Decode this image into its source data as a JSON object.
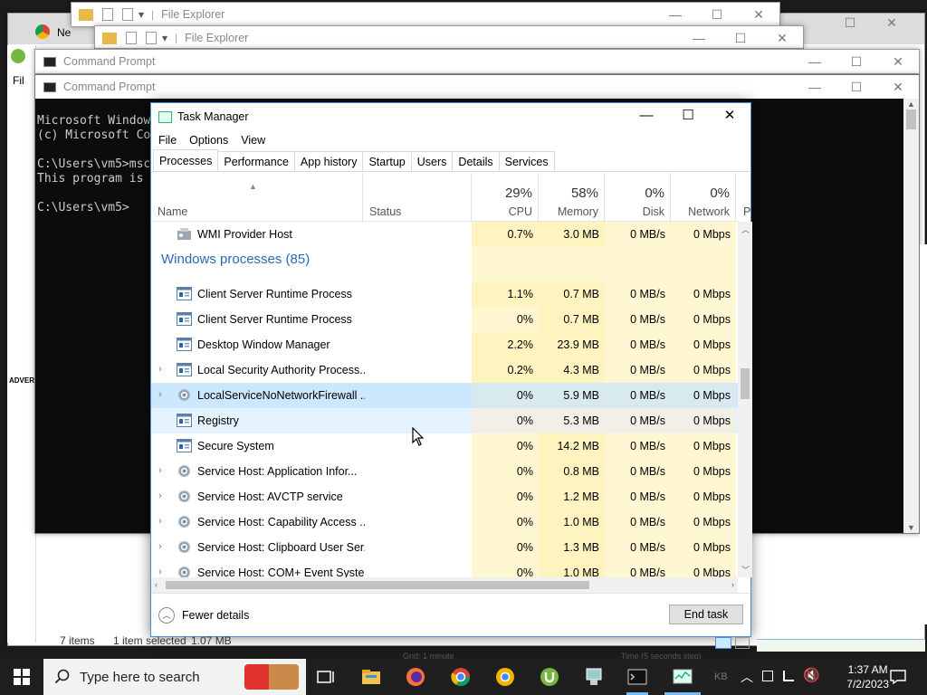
{
  "explorer": {
    "title1": "File Explorer",
    "title2": "File Explorer",
    "items_count": "7 items",
    "selected": "1 item selected",
    "selected_size": "1.07 MB"
  },
  "browser": {
    "tab_label": "Ne"
  },
  "cmd": {
    "title1": "Command Prompt",
    "title2": "Command Prompt",
    "lines": [
      "Microsoft Windows",
      "(c) Microsoft Co",
      "",
      "C:\\Users\\vm5>msc",
      "This program is",
      "",
      "C:\\Users\\vm5>"
    ]
  },
  "background_fragments": {
    "menu_file": "Fil",
    "advert": "ADVERT",
    "graph_label": "Grid: 1 minute",
    "time_label": "Time (5 seconds step)",
    "kb": "KB"
  },
  "taskmanager": {
    "title": "Task Manager",
    "menu": [
      "File",
      "Options",
      "View"
    ],
    "tabs": [
      "Processes",
      "Performance",
      "App history",
      "Startup",
      "Users",
      "Details",
      "Services"
    ],
    "active_tab": "Processes",
    "columns": {
      "name": "Name",
      "status": "Status",
      "cpu_pct": "29%",
      "cpu": "CPU",
      "mem_pct": "58%",
      "mem": "Memory",
      "disk_pct": "0%",
      "disk": "Disk",
      "net_pct": "0%",
      "net": "Network",
      "more": "P"
    },
    "group_title": "Windows processes (85)",
    "rows": [
      {
        "name": "WMI Provider Host",
        "cpu": "0.7%",
        "mem": "3.0 MB",
        "disk": "0 MB/s",
        "net": "0 Mbps",
        "expand": false,
        "icon": "wmi-icon"
      },
      {
        "name": "Client Server Runtime Process",
        "cpu": "1.1%",
        "mem": "0.7 MB",
        "disk": "0 MB/s",
        "net": "0 Mbps",
        "expand": false,
        "icon": "window-icon"
      },
      {
        "name": "Client Server Runtime Process",
        "cpu": "0%",
        "mem": "0.7 MB",
        "disk": "0 MB/s",
        "net": "0 Mbps",
        "expand": false,
        "icon": "window-icon"
      },
      {
        "name": "Desktop Window Manager",
        "cpu": "2.2%",
        "mem": "23.9 MB",
        "disk": "0 MB/s",
        "net": "0 Mbps",
        "expand": false,
        "icon": "window-icon"
      },
      {
        "name": "Local Security Authority Process...",
        "cpu": "0.2%",
        "mem": "4.3 MB",
        "disk": "0 MB/s",
        "net": "0 Mbps",
        "expand": true,
        "icon": "window-icon"
      },
      {
        "name": "LocalServiceNoNetworkFirewall ...",
        "cpu": "0%",
        "mem": "5.9 MB",
        "disk": "0 MB/s",
        "net": "0 Mbps",
        "expand": true,
        "icon": "gear-icon"
      },
      {
        "name": "Registry",
        "cpu": "0%",
        "mem": "5.3 MB",
        "disk": "0 MB/s",
        "net": "0 Mbps",
        "expand": false,
        "icon": "window-icon"
      },
      {
        "name": "Secure System",
        "cpu": "0%",
        "mem": "14.2 MB",
        "disk": "0 MB/s",
        "net": "0 Mbps",
        "expand": false,
        "icon": "window-icon"
      },
      {
        "name": "Service Host: Application Infor...",
        "cpu": "0%",
        "mem": "0.8 MB",
        "disk": "0 MB/s",
        "net": "0 Mbps",
        "expand": true,
        "icon": "gear-icon"
      },
      {
        "name": "Service Host: AVCTP service",
        "cpu": "0%",
        "mem": "1.2 MB",
        "disk": "0 MB/s",
        "net": "0 Mbps",
        "expand": true,
        "icon": "gear-icon"
      },
      {
        "name": "Service Host: Capability Access ...",
        "cpu": "0%",
        "mem": "1.0 MB",
        "disk": "0 MB/s",
        "net": "0 Mbps",
        "expand": true,
        "icon": "gear-icon"
      },
      {
        "name": "Service Host: Clipboard User Ser...",
        "cpu": "0%",
        "mem": "1.3 MB",
        "disk": "0 MB/s",
        "net": "0 Mbps",
        "expand": true,
        "icon": "gear-icon"
      },
      {
        "name": "Service Host: COM+ Event Syste...",
        "cpu": "0%",
        "mem": "1.0 MB",
        "disk": "0 MB/s",
        "net": "0 Mbps",
        "expand": true,
        "icon": "gear-icon"
      }
    ],
    "fewer_details": "Fewer details",
    "end_task": "End task"
  },
  "taskbar": {
    "search_placeholder": "Type here to search",
    "time": "1:37 AM",
    "date": "7/2/2023"
  },
  "colors": {
    "accent": "#0078d7",
    "group_title": "#2a6ab5",
    "heat_light": "#fff7d1",
    "heat": "#fff3c0",
    "selected_row": "#cce8ff"
  }
}
